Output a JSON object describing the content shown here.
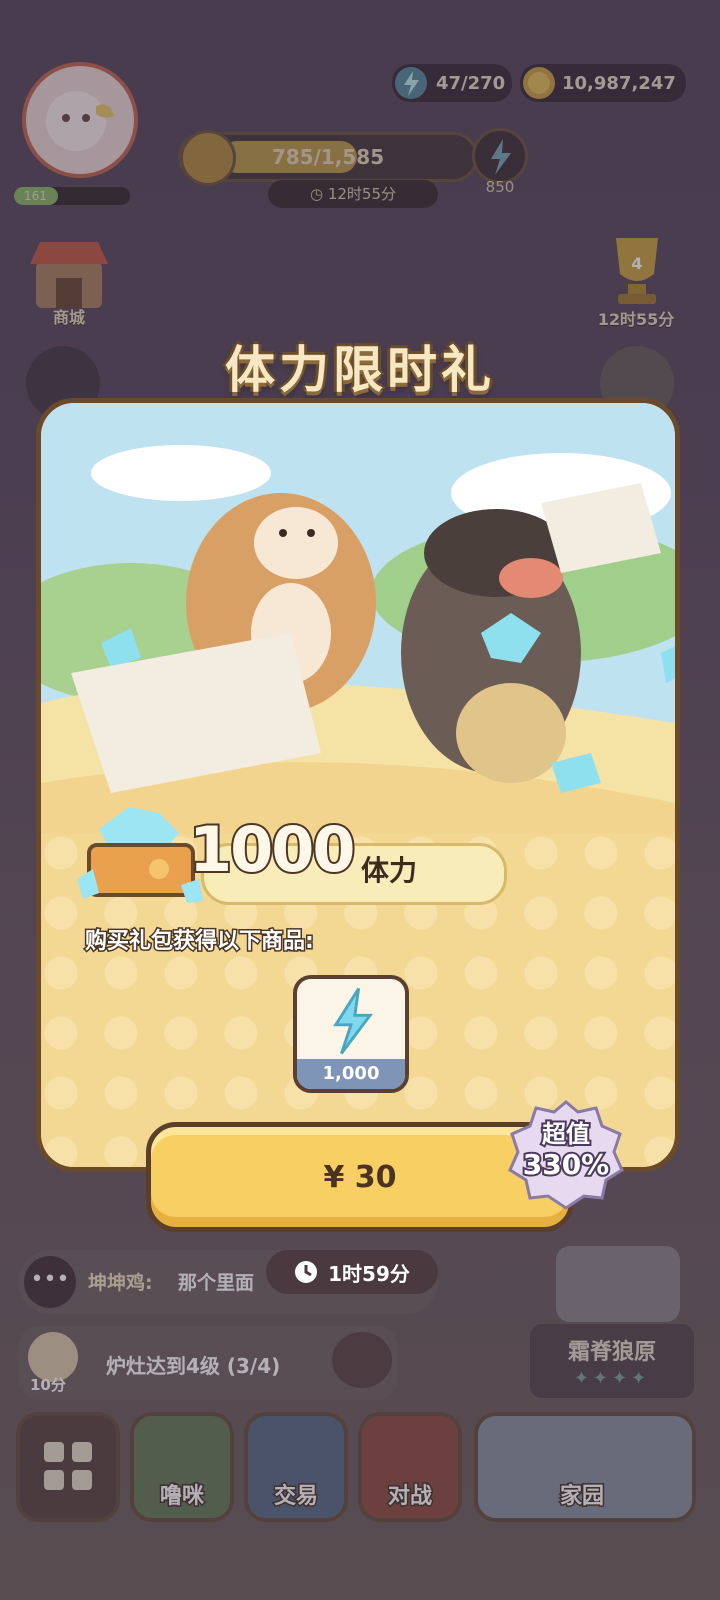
{
  "top_bar": {
    "energy": "47/270",
    "coins": "10,987,247",
    "level": "161"
  },
  "progress": {
    "value": "785/1,585",
    "fill_fraction": 0.5,
    "timer": "12时55分",
    "energy_reward": "850"
  },
  "left_menu": {
    "shop_label": "商城"
  },
  "right_menu": {
    "trophy_count": "4",
    "trophy_timer": "12时55分"
  },
  "gift": {
    "title": "体力限时礼",
    "amount_number": "1000",
    "amount_unit": "体力",
    "buy_caption": "购买礼包获得以下商品:",
    "item_count": "1,000",
    "price": "¥ 30",
    "value_line1": "超值",
    "value_line2": "330%",
    "timer": "1时59分"
  },
  "chat": {
    "sender": "坤坤鸡:",
    "message": "那个里面"
  },
  "task": {
    "time": "10分",
    "text": "炉灶达到4级 (3/4)"
  },
  "area": {
    "name": "霜脊狼原",
    "stars": 4
  },
  "bottom_nav": {
    "items": [
      "噜咪",
      "交易",
      "对战",
      "家园"
    ]
  },
  "colors": {
    "accent": "#f7cf62",
    "card_bg": "#f2d48f",
    "border": "#5b3f2b"
  }
}
